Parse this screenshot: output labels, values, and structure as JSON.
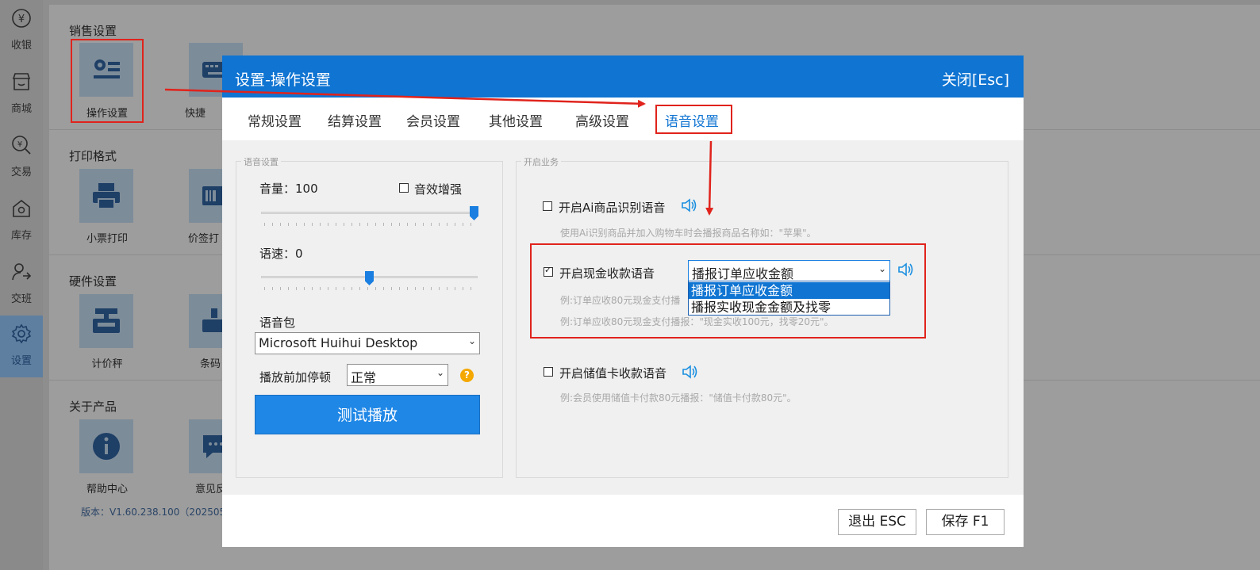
{
  "nav": {
    "items": [
      {
        "label": "收银",
        "icon": "cashier-icon"
      },
      {
        "label": "商城",
        "icon": "store-icon"
      },
      {
        "label": "交易",
        "icon": "trade-icon"
      },
      {
        "label": "库存",
        "icon": "inventory-icon"
      },
      {
        "label": "交班",
        "icon": "shift-icon"
      },
      {
        "label": "设置",
        "icon": "gear-icon",
        "active": true
      }
    ]
  },
  "settings_page": {
    "sections": [
      {
        "title": "销售设置",
        "tiles": [
          {
            "label": "操作设置",
            "icon": "operation-settings-icon"
          },
          {
            "label": "快捷",
            "icon": "keyboard-icon"
          }
        ]
      },
      {
        "title": "打印格式",
        "tiles": [
          {
            "label": "小票打印",
            "icon": "printer-icon"
          },
          {
            "label": "价签打",
            "icon": "price-tag-icon"
          }
        ]
      },
      {
        "title": "硬件设置",
        "tiles": [
          {
            "label": "计价秤",
            "icon": "scale-icon"
          },
          {
            "label": "条码",
            "icon": "barcode-scale-icon"
          }
        ]
      },
      {
        "title": "关于产品",
        "tiles": [
          {
            "label": "帮助中心",
            "icon": "info-icon"
          },
          {
            "label": "意见反",
            "icon": "feedback-icon"
          }
        ]
      }
    ],
    "version": "版本：V1.60.238.100（2025051"
  },
  "modal": {
    "title": "设置-操作设置",
    "close_label": "关闭[Esc]",
    "tabs": [
      "常规设置",
      "结算设置",
      "会员设置",
      "其他设置",
      "高级设置",
      "语音设置"
    ],
    "active_tab": "语音设置",
    "voice_group": {
      "legend": "语音设置",
      "volume_label": "音量：100",
      "volume": 100,
      "enhance_label": "音效增强",
      "enhance_checked": false,
      "speed_label": "语速：0",
      "speed": 0,
      "pack_label": "语音包",
      "pack_value": "Microsoft Huihui Desktop",
      "pause_label": "播放前加停顿",
      "pause_value": "正常",
      "test_label": "测试播放"
    },
    "business_group": {
      "legend": "开启业务",
      "ai": {
        "label": "开启Ai商品识别语音",
        "checked": false,
        "hint": "使用Ai识别商品并加入购物车时会播报商品名称如：\"苹果\"。"
      },
      "cash": {
        "label": "开启现金收款语音",
        "checked": true,
        "select_value": "播报订单应收金额",
        "options": [
          "播报订单应收金额",
          "播报实收现金金额及找零"
        ],
        "hint1": "例:订单应收80元现金支付播",
        "hint2": "例:订单应收80元现金支付播报：\"现金实收100元，找零20元\"。"
      },
      "card": {
        "label": "开启储值卡收款语音",
        "checked": false,
        "hint": "例:会员使用储值卡付款80元播报：\"储值卡付款80元\"。"
      }
    },
    "footer": {
      "exit_label": "退出 ESC",
      "save_label": "保存 F1"
    }
  },
  "colors": {
    "accent": "#0f74d2",
    "annotation": "#e0231c"
  }
}
